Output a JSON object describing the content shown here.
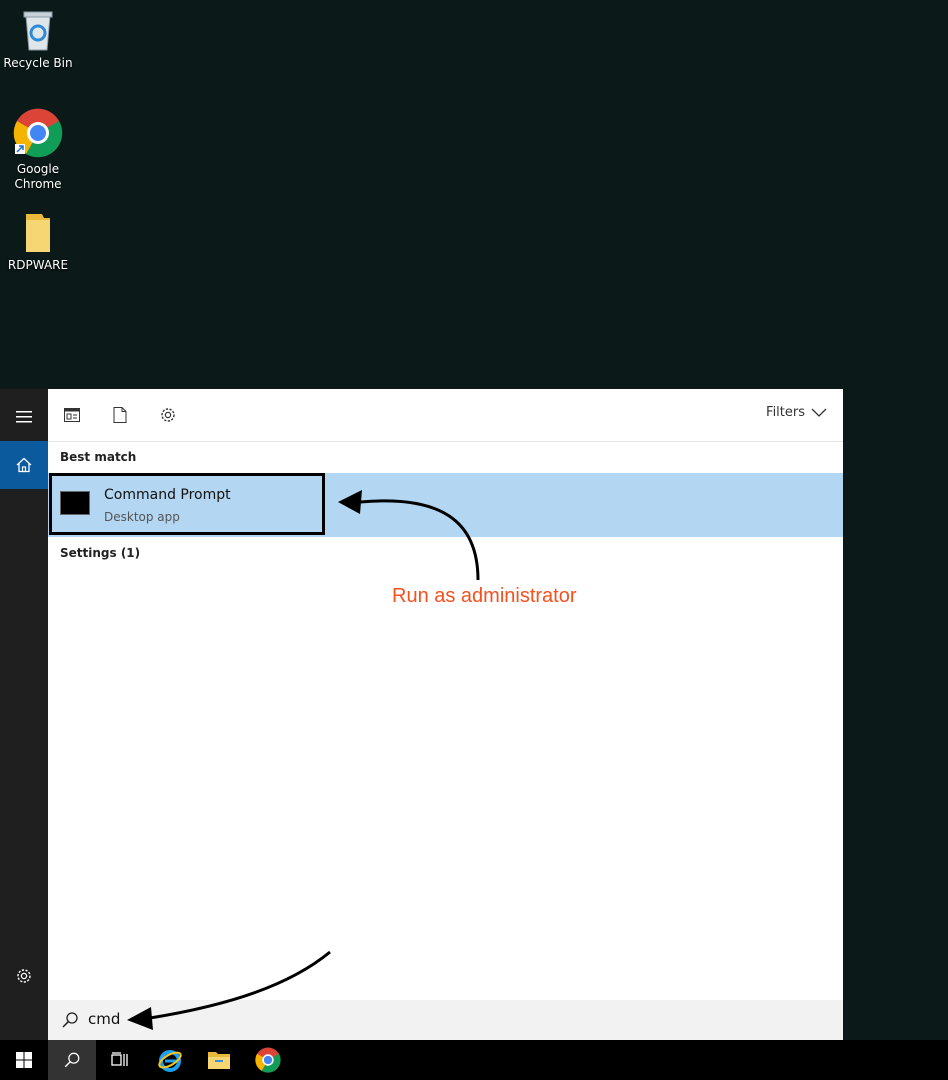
{
  "desktop": {
    "icons": [
      {
        "label": "Recycle Bin",
        "icon": "recycle-bin-icon"
      },
      {
        "label": "Google\nChrome",
        "icon": "chrome-icon"
      },
      {
        "label": "RDPWARE",
        "icon": "folder-icon"
      }
    ]
  },
  "start_menu": {
    "toolbar": {
      "filters_label": "Filters"
    },
    "best_match_label": "Best match",
    "best_match": {
      "title": "Command Prompt",
      "subtitle": "Desktop app"
    },
    "settings_label": "Settings (1)",
    "search": {
      "value": "cmd"
    }
  },
  "annotation": {
    "text": "Run as administrator",
    "color": "#f4511e"
  },
  "colors": {
    "desktop_bg": "#0b1919",
    "selection": "#b3d6f2",
    "home_accent": "#0b5a9e"
  }
}
